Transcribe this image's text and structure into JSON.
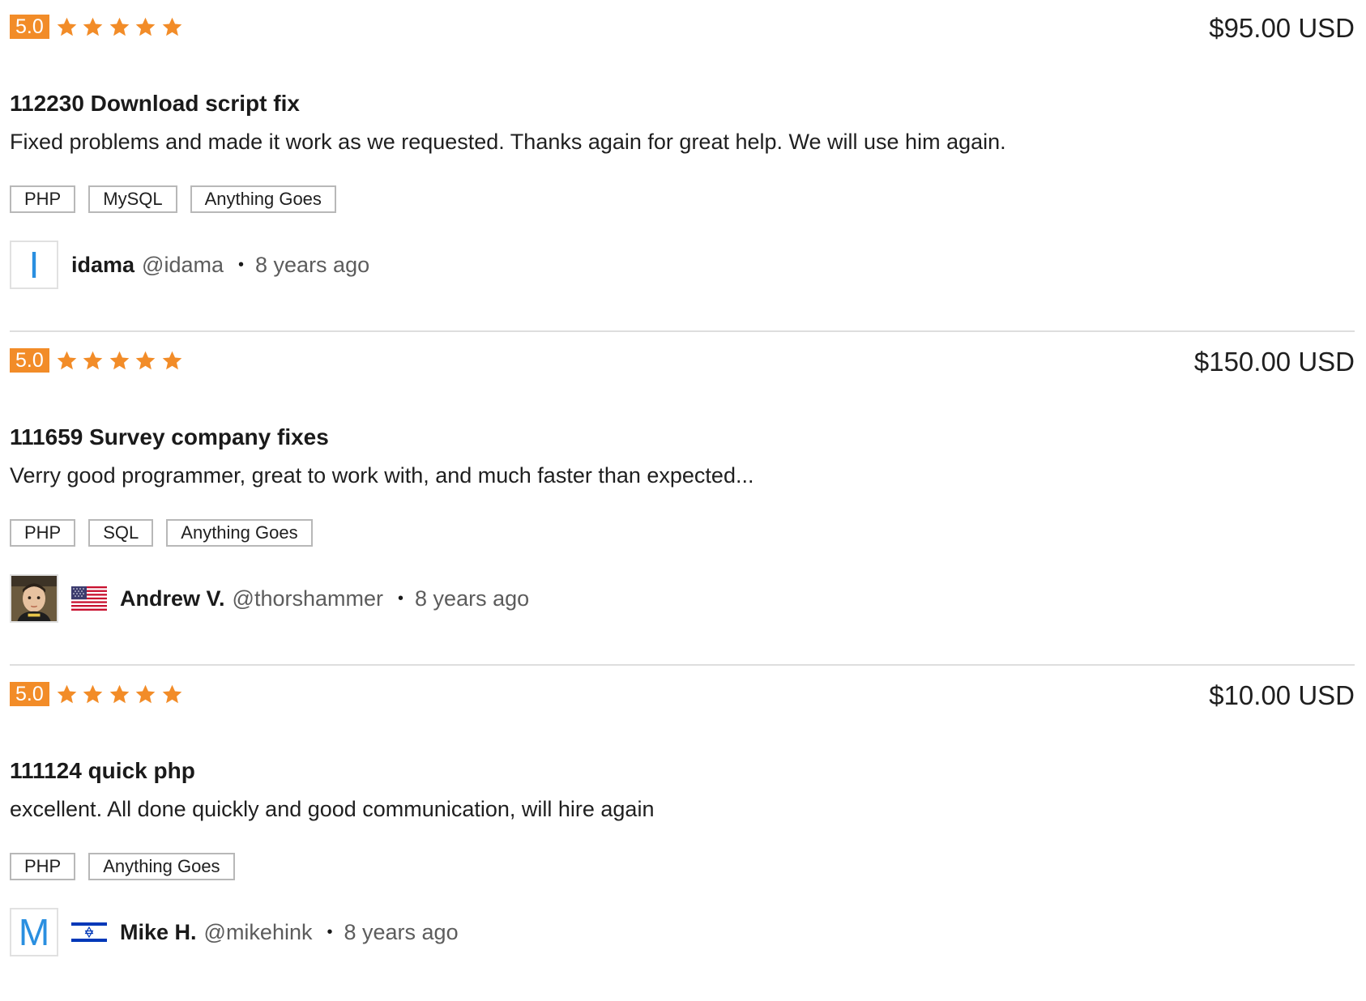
{
  "reviews": [
    {
      "rating": "5.0",
      "stars": 5,
      "price": "$95.00 USD",
      "title": "112230 Download script fix",
      "text": "Fixed problems and made it work as we requested. Thanks again for great help. We will use him again.",
      "skills": [
        "PHP",
        "MySQL",
        "Anything Goes"
      ],
      "reviewer": {
        "avatar_letter": "I",
        "name": "idama",
        "username": "@idama",
        "flag": "",
        "time": "8 years ago"
      }
    },
    {
      "rating": "5.0",
      "stars": 5,
      "price": "$150.00 USD",
      "title": "111659 Survey company fixes",
      "text": "Verry good programmer, great to work with, and much faster than expected...",
      "skills": [
        "PHP",
        "SQL",
        "Anything Goes"
      ],
      "reviewer": {
        "avatar_letter": "",
        "name": "Andrew V.",
        "username": "@thorshammer",
        "flag": "us-flag-icon",
        "time": "8 years ago"
      }
    },
    {
      "rating": "5.0",
      "stars": 5,
      "price": "$10.00 USD",
      "title": "111124 quick php",
      "text": "excellent. All done quickly and good communication, will hire again",
      "skills": [
        "PHP",
        "Anything Goes"
      ],
      "reviewer": {
        "avatar_letter": "M",
        "name": "Mike H.",
        "username": "@mikehink",
        "flag": "israel-flag-icon",
        "time": "8 years ago"
      }
    }
  ],
  "colors": {
    "rating_badge": "#f28c28",
    "star": "#f28c28",
    "avatar_letter": "#2a8fe0",
    "divider": "#dedede"
  }
}
